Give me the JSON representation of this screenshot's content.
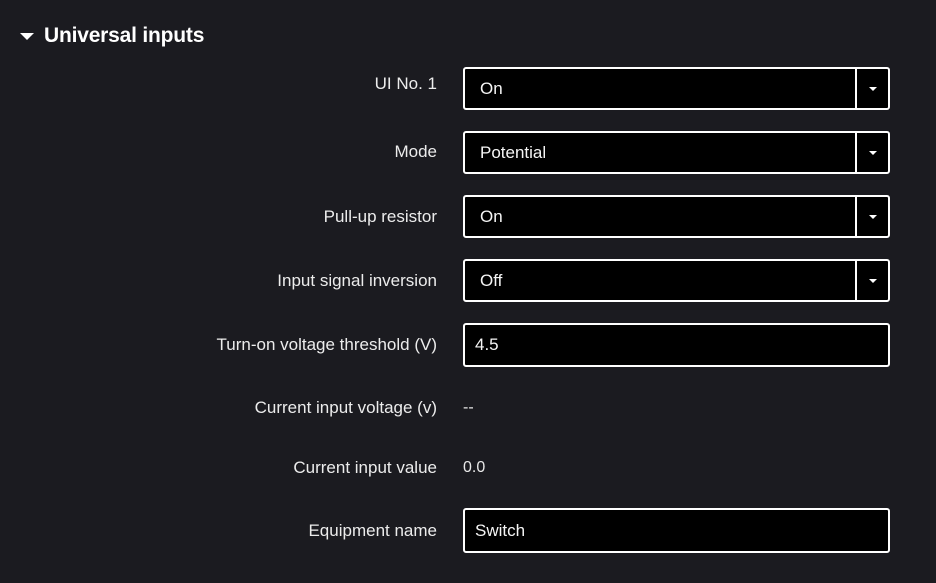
{
  "section": {
    "title": "Universal inputs",
    "expanded": true
  },
  "fields": {
    "ui_no": {
      "label": "UI No. 1",
      "value": "On"
    },
    "mode": {
      "label": "Mode",
      "value": "Potential"
    },
    "pullup": {
      "label": "Pull-up resistor",
      "value": "On"
    },
    "inversion": {
      "label": "Input signal inversion",
      "value": "Off"
    },
    "threshold": {
      "label": "Turn-on voltage threshold (V)",
      "value": "4.5"
    },
    "current_voltage": {
      "label": "Current input voltage (v)",
      "value": "--"
    },
    "current_value": {
      "label": "Current input value",
      "value": "0.0"
    },
    "equipment_name": {
      "label": "Equipment name",
      "value": "Switch"
    }
  },
  "icons": {
    "section_toggle": "caret-down-icon",
    "select_arrow": "chevron-down-icon"
  },
  "colors": {
    "background": "#1b1b20",
    "control_background": "#000000",
    "control_border": "#ffffff",
    "text": "#f2f2f2"
  }
}
